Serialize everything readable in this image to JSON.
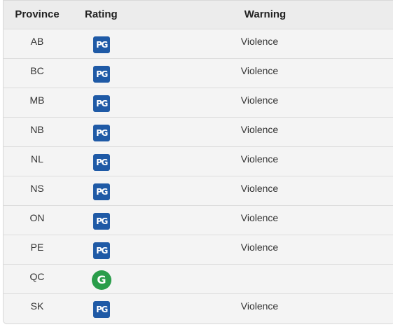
{
  "table": {
    "headers": {
      "province": "Province",
      "rating": "Rating",
      "warning": "Warning"
    },
    "rows": [
      {
        "province": "AB",
        "rating": "PG",
        "rating_icon": "pg-rating-icon",
        "warning": "Violence"
      },
      {
        "province": "BC",
        "rating": "PG",
        "rating_icon": "pg-rating-icon",
        "warning": "Violence"
      },
      {
        "province": "MB",
        "rating": "PG",
        "rating_icon": "pg-rating-icon",
        "warning": "Violence"
      },
      {
        "province": "NB",
        "rating": "PG",
        "rating_icon": "pg-rating-icon",
        "warning": "Violence"
      },
      {
        "province": "NL",
        "rating": "PG",
        "rating_icon": "pg-rating-icon",
        "warning": "Violence"
      },
      {
        "province": "NS",
        "rating": "PG",
        "rating_icon": "pg-rating-icon",
        "warning": "Violence"
      },
      {
        "province": "ON",
        "rating": "PG",
        "rating_icon": "pg-rating-icon",
        "warning": "Violence"
      },
      {
        "province": "PE",
        "rating": "PG",
        "rating_icon": "pg-rating-icon",
        "warning": "Violence"
      },
      {
        "province": "QC",
        "rating": "G",
        "rating_icon": "g-rating-icon",
        "warning": ""
      },
      {
        "province": "SK",
        "rating": "PG",
        "rating_icon": "pg-rating-icon",
        "warning": "Violence"
      }
    ]
  },
  "colors": {
    "pg_badge": "#1f5aa6",
    "g_badge": "#2a9d4a",
    "header_bg": "#ececec",
    "row_bg": "#f4f4f4"
  }
}
